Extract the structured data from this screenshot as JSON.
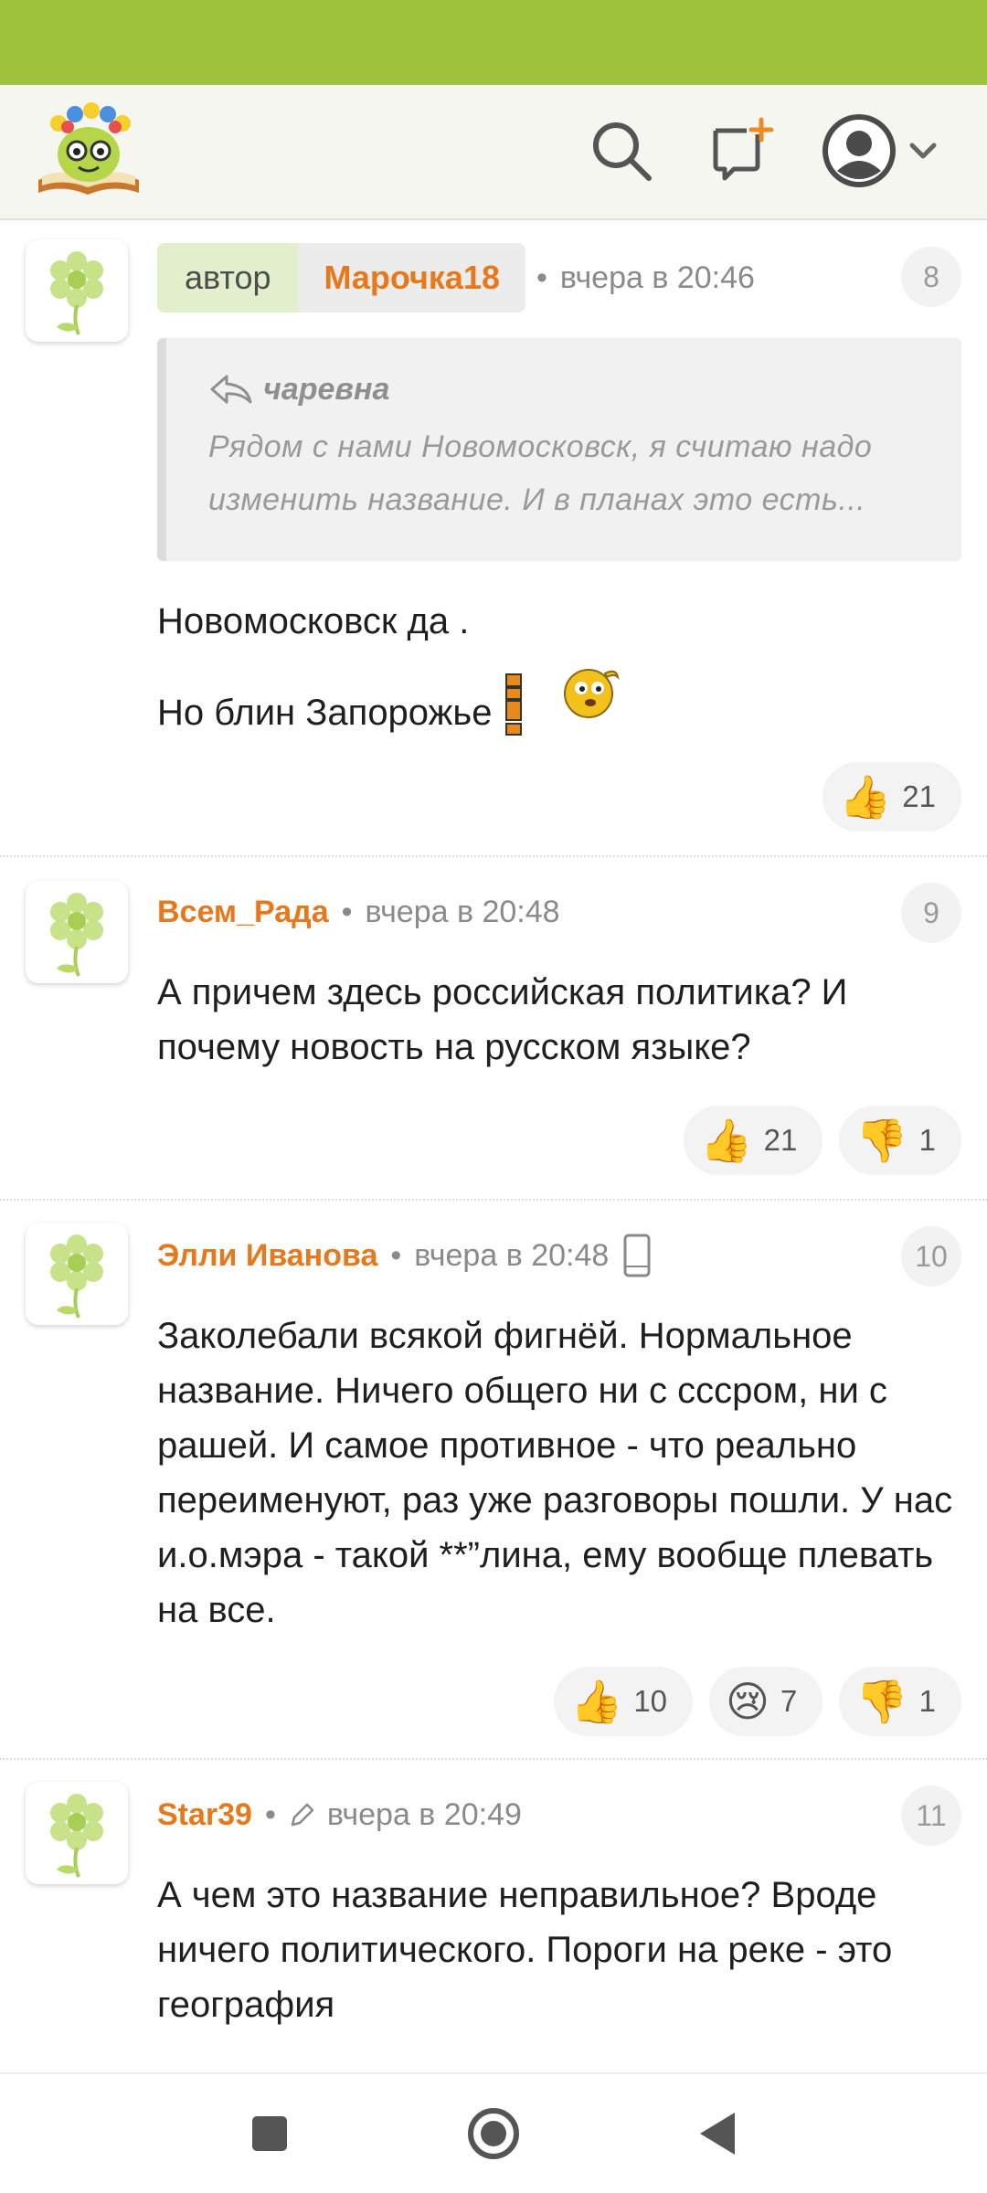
{
  "header": {
    "logo_icon": "smiley-book-logo",
    "search_icon": "search-icon",
    "new_post_icon": "new-post-icon",
    "profile_icon": "avatar-icon"
  },
  "comments": [
    {
      "author_tag": "автор",
      "username": "Марочка18",
      "time": "вчера в 20:46",
      "number": "8",
      "quote": {
        "author": "чаревна",
        "text": "Рядом с нами Новомосковск, я считаю надо изменить название. И в планах это есть..."
      },
      "lines": [
        "Новомосковск да .",
        "Но блин Запорожье"
      ],
      "reactions": [
        {
          "icon": "thumbs-up",
          "emoji": "👍",
          "count": "21"
        }
      ]
    },
    {
      "username": "Всем_Рада",
      "time": "вчера в 20:48",
      "number": "9",
      "text": "А причем здесь российская политика? И почему новость на русском языке?",
      "reactions": [
        {
          "icon": "thumbs-up",
          "emoji": "👍",
          "count": "21"
        },
        {
          "icon": "thumbs-down",
          "emoji": "👎",
          "count": "1"
        }
      ]
    },
    {
      "username": "Элли Иванова",
      "time": "вчера в 20:48",
      "number": "10",
      "device_icon": "mobile-phone-icon",
      "text": "Заколебали всякой фигнёй. Нормальное название. Ничего общего ни с сссром, ни с рашей. И самое противное - что реально переименуют, раз уже разговоры пошли. У нас и.о.мэра - такой **”лина, ему вообще плевать на все.",
      "reactions": [
        {
          "icon": "thumbs-up",
          "emoji": "👍",
          "count": "10"
        },
        {
          "icon": "crying-face",
          "emoji": "😢",
          "count": "7"
        },
        {
          "icon": "thumbs-down",
          "emoji": "👎",
          "count": "1"
        }
      ]
    },
    {
      "username": "Star39",
      "time": "вчера в 20:49",
      "number": "11",
      "edited_icon": "pencil-icon",
      "text": "А чем это название неправильное? Вроде ничего политического. Пороги на реке - это география"
    }
  ],
  "colors": {
    "status_bar": "#9cc33b",
    "username": "#e8781c",
    "author_tag_bg": "#e3efcc"
  }
}
